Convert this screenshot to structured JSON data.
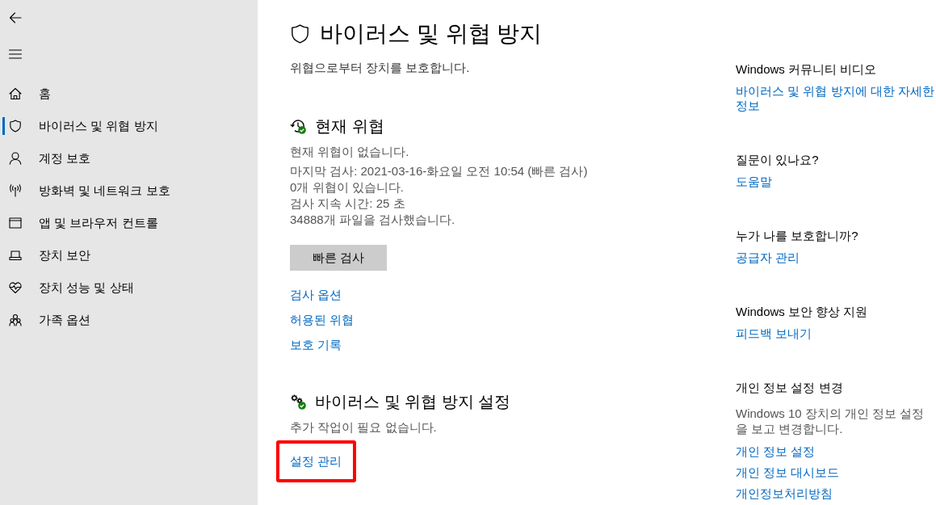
{
  "sidebar": {
    "items": [
      {
        "label": "홈",
        "selected": false
      },
      {
        "label": "바이러스 및 위협 방지",
        "selected": true
      },
      {
        "label": "계정 보호",
        "selected": false
      },
      {
        "label": "방화벽 및 네트워크 보호",
        "selected": false
      },
      {
        "label": "앱 및 브라우저 컨트롤",
        "selected": false
      },
      {
        "label": "장치 보안",
        "selected": false
      },
      {
        "label": "장치 성능 및 상태",
        "selected": false
      },
      {
        "label": "가족 옵션",
        "selected": false
      }
    ]
  },
  "main": {
    "title": "바이러스 및 위협 방지",
    "subtitle": "위협으로부터 장치를 보호합니다.",
    "sections": [
      {
        "heading": "현재 위협",
        "details": [
          "현재 위협이 없습니다.",
          "마지막 검사: 2021-03-16-화요일 오전 10:54 (빠른 검사)",
          "0개 위협이 있습니다.",
          "검사 지속 시간: 25 초",
          "34888개 파일을 검사했습니다."
        ],
        "button": "빠른 검사",
        "links": [
          {
            "label": "검사 옵션",
            "highlighted": false
          },
          {
            "label": "허용된 위협",
            "highlighted": false
          },
          {
            "label": "보호 기록",
            "highlighted": false
          }
        ]
      },
      {
        "heading": "바이러스 및 위협 방지 설정",
        "details": [
          "추가 작업이 필요 없습니다."
        ],
        "links": [
          {
            "label": "설정 관리",
            "highlighted": true
          }
        ]
      }
    ]
  },
  "aside": {
    "groups": [
      {
        "heading": "Windows 커뮤니티 비디오",
        "links": [
          "바이러스 및 위협 방지에 대한 자세한 정보"
        ]
      },
      {
        "heading": "질문이 있나요?",
        "links": [
          "도움말"
        ]
      },
      {
        "heading": "누가 나를 보호합니까?",
        "links": [
          "공급자 관리"
        ]
      },
      {
        "heading": "Windows 보안 향상 지원",
        "links": [
          "피드백 보내기"
        ]
      },
      {
        "heading": "개인 정보 설정 변경",
        "description": "Windows 10 장치의 개인 정보 설정을 보고 변경합니다.",
        "links": [
          "개인 정보 설정",
          "개인 정보 대시보드",
          "개인정보처리방침"
        ]
      }
    ]
  }
}
